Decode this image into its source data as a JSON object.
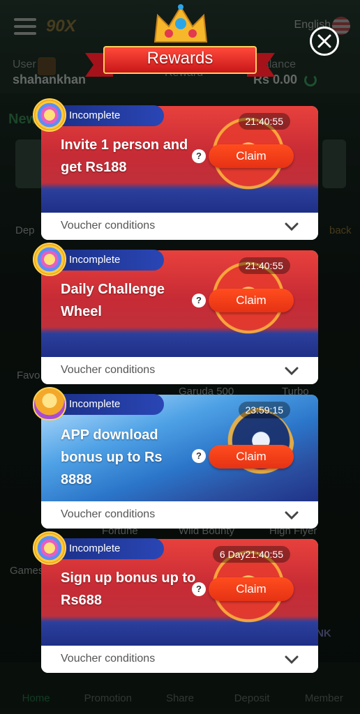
{
  "background": {
    "header": {
      "logo": "90X",
      "language": "English"
    },
    "userbar": {
      "user_label": "User",
      "username": "shahankhan",
      "reward_label": "Reward",
      "balance_label": "Balance",
      "balance": "Rs 0.00"
    },
    "labels": {
      "new": "New",
      "deposit": "Dep",
      "back": "back",
      "fav": "Favo",
      "garuda": "Garuda 500",
      "turbo": "Turbo",
      "fortune": "Fortune",
      "wild_bounty": "Wild Bounty",
      "high_flyer": "High Flyer",
      "games": "Games",
      "piggy": "PIGGY BANK"
    },
    "nav": [
      "Home",
      "Promotion",
      "Share",
      "Deposit",
      "Member"
    ]
  },
  "modal": {
    "title": "Rewards",
    "cards": [
      {
        "status": "Incomplete",
        "timer": "21:40:55",
        "title": "Invite 1 person and get Rs188",
        "claim": "Claim",
        "voucher": "Voucher conditions"
      },
      {
        "status": "Incomplete",
        "timer": "21:40:55",
        "title": "Daily Challenge Wheel",
        "claim": "Claim",
        "voucher": "Voucher conditions"
      },
      {
        "status": "Incomplete",
        "timer": "23:59:15",
        "title": "APP download bonus up to Rs 8888",
        "claim": "Claim",
        "voucher": "Voucher conditions"
      },
      {
        "status": "Incomplete",
        "timer": "6 Day21:40:55",
        "title": "Sign up bonus up to Rs688",
        "claim": "Claim",
        "voucher": "Voucher conditions"
      }
    ]
  },
  "icons": {
    "close": "close-icon",
    "help": "help-icon",
    "chevron": "chevron-down-icon"
  }
}
